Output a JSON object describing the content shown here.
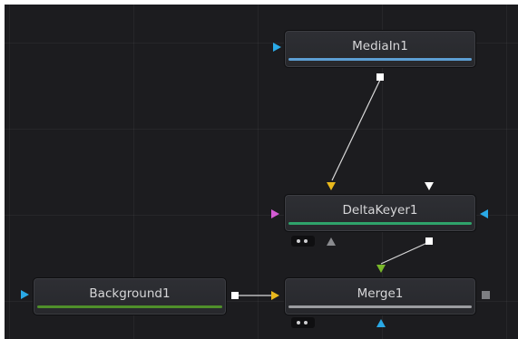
{
  "nodes": {
    "mediain": {
      "label": "MediaIn1",
      "bar_color": "#5d9fd4"
    },
    "deltakeyer": {
      "label": "DeltaKeyer1",
      "bar_color": "#2fa36b"
    },
    "background": {
      "label": "Background1",
      "bar_color": "#4f8f2a"
    },
    "merge": {
      "label": "Merge1",
      "bar_color": "#9b9ca0"
    }
  },
  "colors": {
    "canvas": "#1c1c1f",
    "input_foreground": "#e8b81c",
    "input_background": "#e8b81c",
    "input_effect_mask": "#d45bd4",
    "input_garbage_mask": "#2aa9e6",
    "input_merge_foreground": "#79b82a",
    "view_input": "#2aa9e6",
    "output_port": "#ffffff",
    "link": "#d9d9d9"
  },
  "icons": [
    "triangle-input-icon",
    "square-output-icon",
    "viewer-toggle-icon"
  ]
}
